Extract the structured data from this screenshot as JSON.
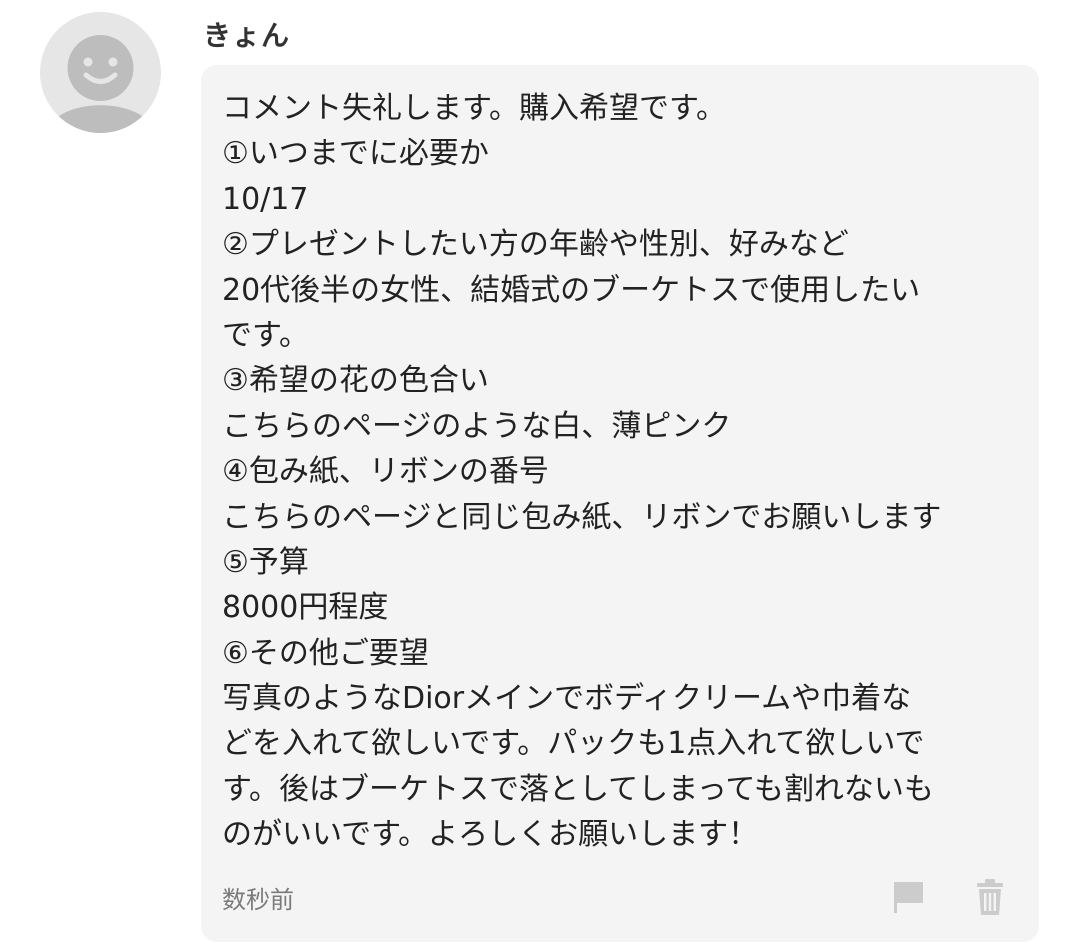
{
  "comment": {
    "username": "きょん",
    "lines": [
      "コメント失礼します。購入希望です。",
      "①いつまでに必要か",
      "10/17",
      "②プレゼントしたい方の年齢や性別、好みなど",
      "20代後半の女性、結婚式のブーケトスで使用したい",
      "です。",
      "③希望の花の色合い",
      "こちらのページのような白、薄ピンク",
      "④包み紙、リボンの番号",
      "こちらのページと同じ包み紙、リボンでお願いします",
      "⑤予算",
      "8000円程度",
      "⑥その他ご要望",
      "写真のようなDiorメインでボディクリームや巾着な",
      "どを入れて欲しいです。パックも1点入れて欲しいで",
      "す。後はブーケトスで落としてしまっても割れないも",
      "のがいいです。よろしくお願いします！"
    ],
    "timestamp": "数秒前",
    "icons": {
      "avatar": "default-user-avatar",
      "report": "flag-icon",
      "delete": "trash-icon"
    }
  },
  "colors": {
    "bubble_background": "#f4f4f4",
    "avatar_background": "#e6e6e6",
    "avatar_figure": "#bdbdbd",
    "action_icon": "#cccccc",
    "timestamp_text": "#7a7a7a"
  }
}
